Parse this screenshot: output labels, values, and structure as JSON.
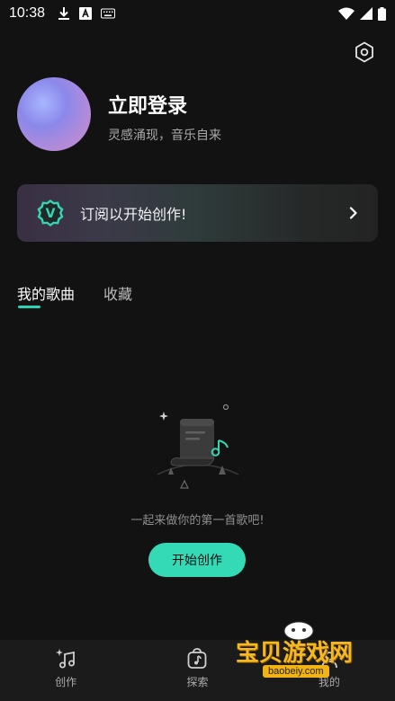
{
  "status_bar": {
    "time": "10:38"
  },
  "profile": {
    "login_title": "立即登录",
    "subtitle": "灵感涌现，音乐自来"
  },
  "subscribe_banner": {
    "badge_letter": "V",
    "text": "订阅以开始创作!"
  },
  "tabs": [
    {
      "label": "我的歌曲",
      "active": true
    },
    {
      "label": "收藏",
      "active": false
    }
  ],
  "empty_state": {
    "message": "一起来做你的第一首歌吧!",
    "button_label": "开始创作"
  },
  "bottom_nav": [
    {
      "label": "创作",
      "icon": "music-notes-sparkle-icon"
    },
    {
      "label": "探索",
      "icon": "music-note-bag-icon"
    },
    {
      "label": "我的",
      "icon": "profile-icon"
    }
  ],
  "watermark": {
    "text": "宝贝游戏网",
    "url": "baobeiy.com"
  },
  "colors": {
    "background": "#121212",
    "accent": "#34d9b6",
    "indicator": "#2ad3b3",
    "nav_background": "#1b1b1b"
  }
}
